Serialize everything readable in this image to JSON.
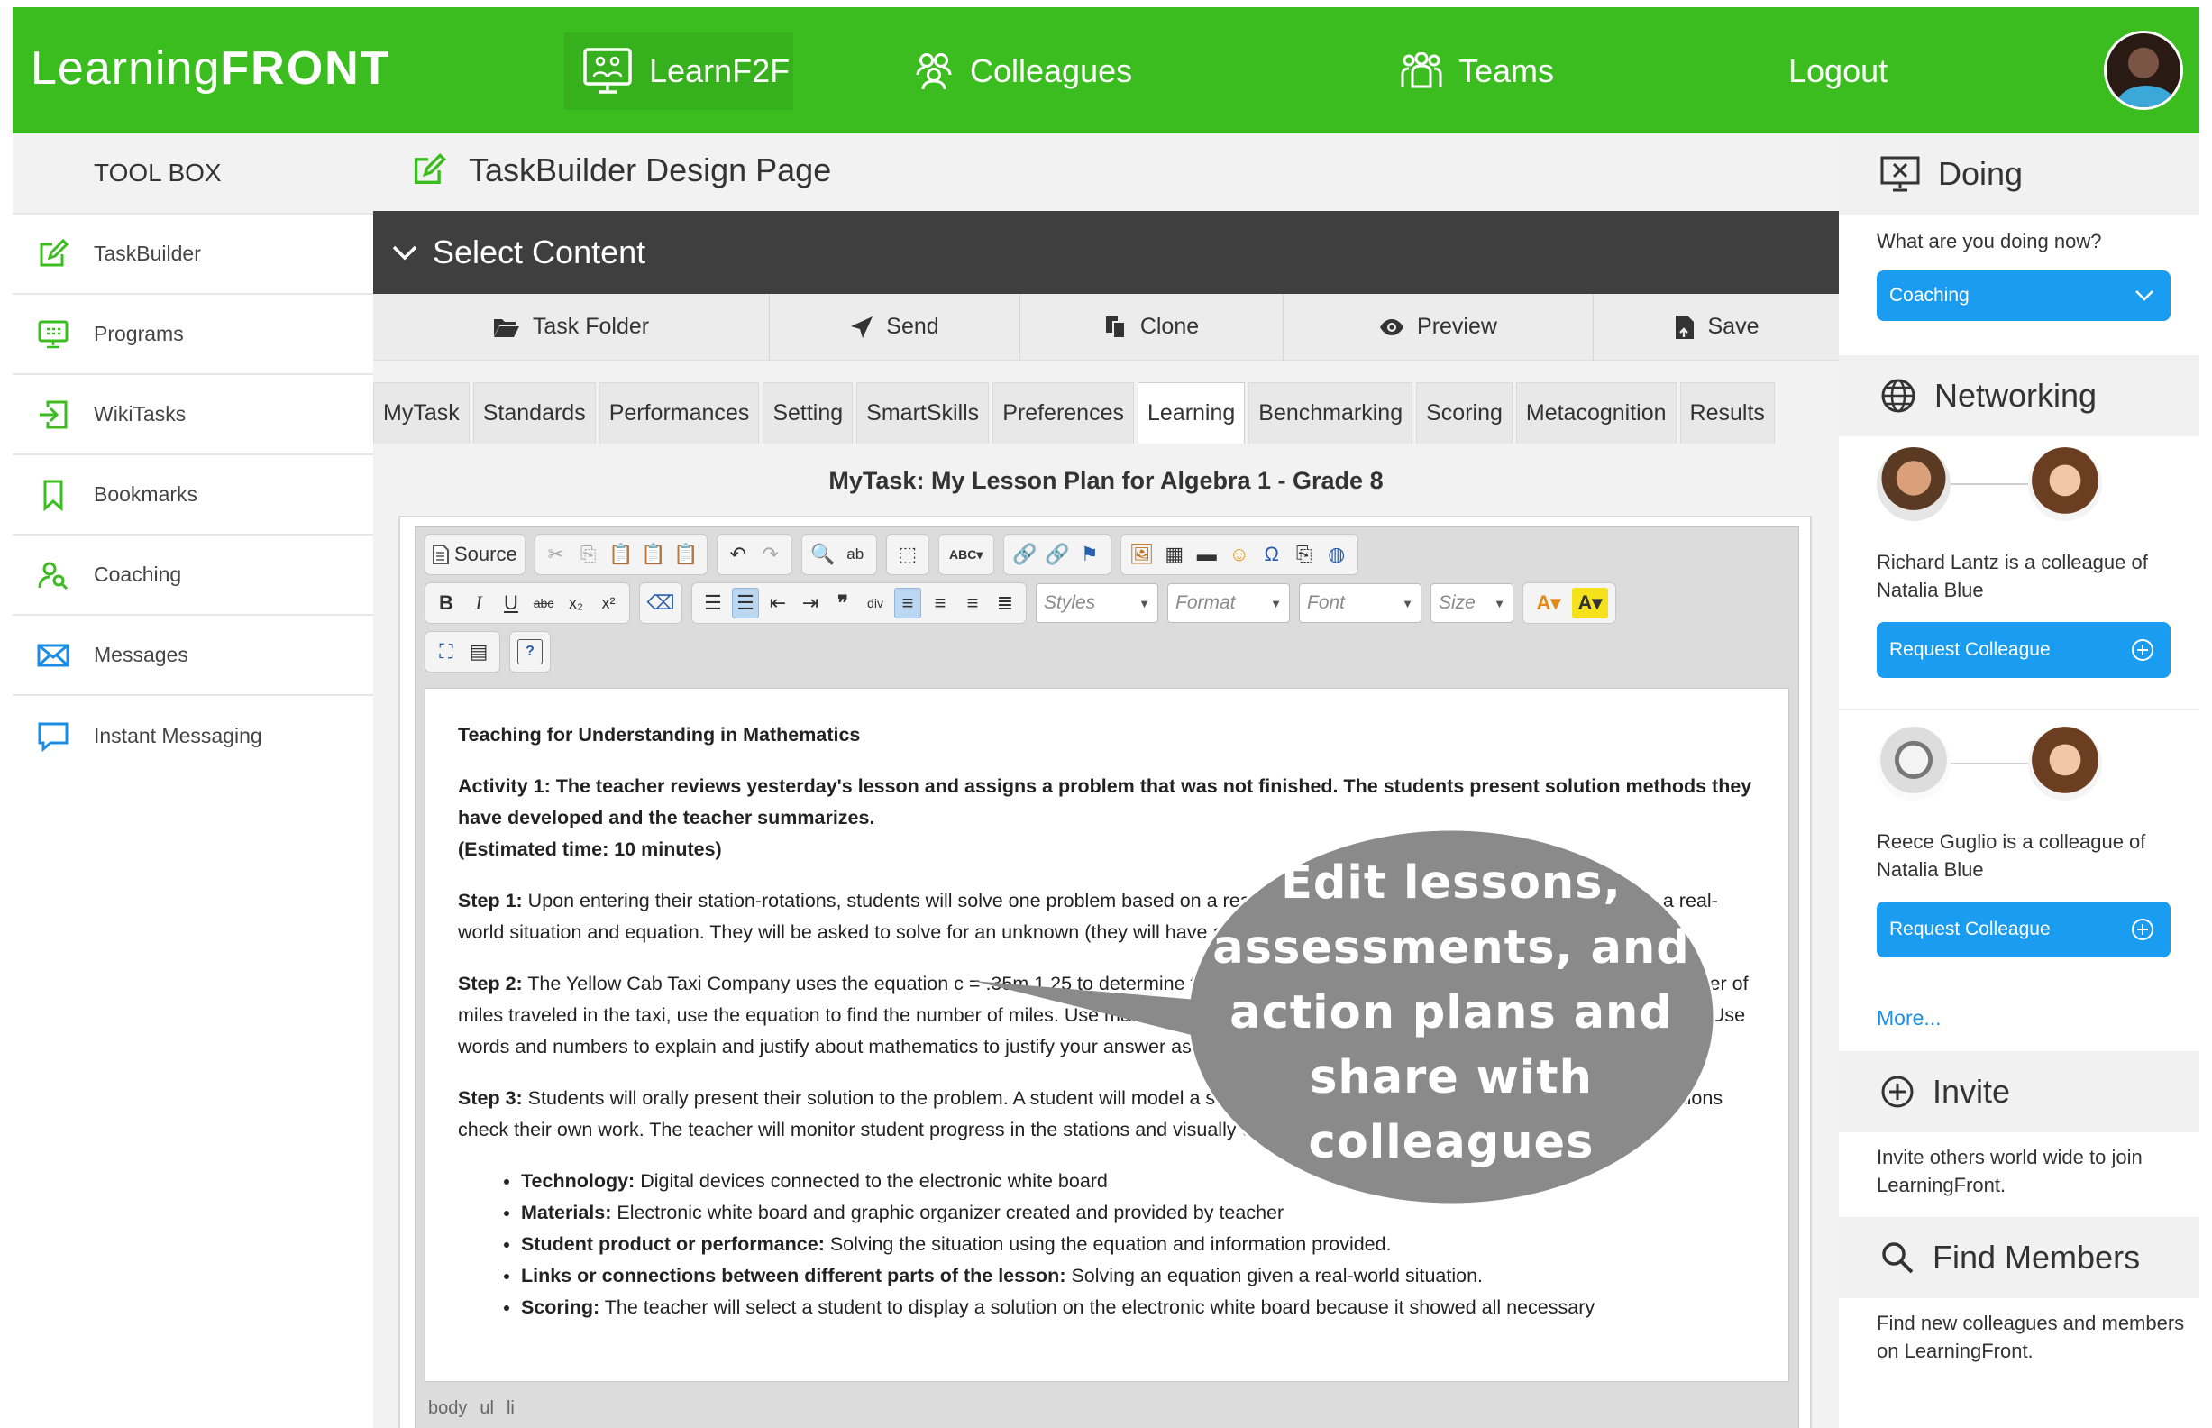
{
  "header": {
    "logo_light": "Learning",
    "logo_bold": "FRONT",
    "nav": [
      {
        "label": "LearnF2F",
        "icon": "presentation-board-icon"
      },
      {
        "label": "Colleagues",
        "icon": "people-icon"
      },
      {
        "label": "Teams",
        "icon": "team-icon"
      },
      {
        "label": "Logout",
        "icon": ""
      }
    ],
    "brand_color": "#3bbd1f"
  },
  "toolbox": {
    "title": "TOOL BOX",
    "items": [
      {
        "label": "TaskBuilder",
        "icon": "edit-icon"
      },
      {
        "label": "Programs",
        "icon": "monitor-icon"
      },
      {
        "label": "WikiTasks",
        "icon": "sign-in-icon"
      },
      {
        "label": "Bookmarks",
        "icon": "bookmark-icon"
      },
      {
        "label": "Coaching",
        "icon": "user-search-icon"
      },
      {
        "label": "Messages",
        "icon": "envelope-icon"
      },
      {
        "label": "Instant Messaging",
        "icon": "chat-icon"
      }
    ]
  },
  "main": {
    "page_title": "TaskBuilder Design Page",
    "section_title": "Select Content",
    "actions": [
      {
        "label": "Task Folder",
        "icon": "folder-open-icon"
      },
      {
        "label": "Send",
        "icon": "paper-plane-icon"
      },
      {
        "label": "Clone",
        "icon": "copy-icon"
      },
      {
        "label": "Preview",
        "icon": "eye-icon"
      },
      {
        "label": "Save",
        "icon": "save-file-icon"
      }
    ],
    "tabs": [
      "MyTask",
      "Standards",
      "Performances",
      "Setting",
      "SmartSkills",
      "Preferences",
      "Learning",
      "Benchmarking",
      "Scoring",
      "Metacognition",
      "Results"
    ],
    "active_tab": "Learning",
    "mytask_title": "MyTask: My Lesson Plan for Algebra 1 - Grade 8"
  },
  "editor": {
    "source_label": "Source",
    "styles_label": "Styles",
    "format_label": "Format",
    "font_label": "Font",
    "size_label": "Size",
    "content": {
      "heading": "Teaching for Understanding in Mathematics",
      "activity1": "Activity 1: The teacher reviews yesterday's lesson and assigns a problem that was not finished. The students present solution methods they have developed and the teacher summarizes.",
      "activity1_time": "(Estimated time: 10 minutes)",
      "step1_label": "Step 1:",
      "step1_text": "Upon entering their station-rotations, students will solve one problem based on a real-world scenario. The problem will give students a real-world situation and equation. They will be asked to solve for an unknown (they will have all the necessary components to solve).",
      "step2_label": "Step 2:",
      "step2_text": "The Yellow Cab Taxi Company uses the equation c = .35m 1.25 to determine the cost in dollars c of a taxi ride and m represents the number of miles traveled in the taxi, use the equation to find the number of miles. Use mathematics to justify your answer as you collaborate in your stations. Use words and numbers to explain and justify about mathematics to justify your answer as you collaborate in your stations. Use words and numbers.",
      "step3_label": "Step 3:",
      "step3_text": "Students will orally present their solution to the problem. A student will model a solution, while the students in their blended learning stations check their own work. The teacher will monitor student progress in the stations and visually check student work.",
      "bullets": [
        {
          "label": "Technology:",
          "text": "Digital devices connected to the electronic white board"
        },
        {
          "label": "Materials:",
          "text": "Electronic white board and graphic organizer created and provided by teacher"
        },
        {
          "label": "Student product or performance:",
          "text": "Solving the situation using the equation and information provided."
        },
        {
          "label": "Links or connections between different parts of the lesson:",
          "text": "Solving an equation given a real-world situation."
        },
        {
          "label": "Scoring:",
          "text": "The teacher will select a student to display a solution on the electronic white board because it showed all necessary"
        }
      ]
    },
    "path": [
      "body",
      "ul",
      "li"
    ]
  },
  "callout": {
    "lines": [
      "Edit lessons,",
      "assessments, and",
      "action plans and",
      "share with",
      "colleagues"
    ]
  },
  "right": {
    "doing": {
      "title": "Doing",
      "prompt": "What are you doing now?",
      "selected": "Coaching"
    },
    "networking": {
      "title": "Networking",
      "entries": [
        {
          "text": "Richard Lantz is a colleague of Natalia Blue",
          "button": "Request Colleague"
        },
        {
          "text": "Reece Guglio is a colleague of Natalia Blue",
          "button": "Request Colleague"
        }
      ],
      "more": "More..."
    },
    "invite": {
      "title": "Invite",
      "text": "Invite others world wide to join LearningFront."
    },
    "find": {
      "title": "Find Members",
      "text": "Find new colleagues and members on LearningFront."
    }
  }
}
